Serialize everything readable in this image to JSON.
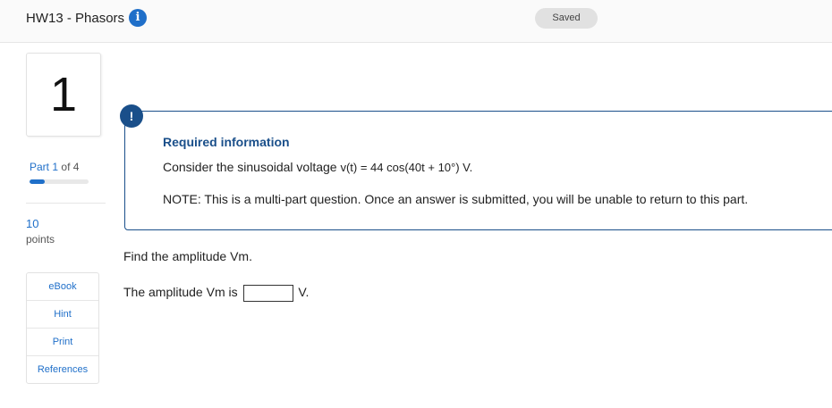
{
  "header": {
    "title": "HW13 - Phasors",
    "info_icon": "info-icon",
    "saved_label": "Saved"
  },
  "sidebar": {
    "question_number": "1",
    "part_word": "Part",
    "part_current": "1",
    "part_of": "of 4",
    "progress_fraction": 0.25,
    "points_value": "10",
    "points_label": "points",
    "tools": [
      {
        "label": "eBook"
      },
      {
        "label": "Hint"
      },
      {
        "label": "Print"
      },
      {
        "label": "References"
      }
    ]
  },
  "required_info": {
    "badge": "!",
    "title": "Required information",
    "body_prefix": "Consider the sinusoidal voltage ",
    "equation": "v(t) = 44 cos(40t + 10°) V.",
    "note": "NOTE: This is a multi-part question. Once an answer is submitted, you will be unable to return to this part."
  },
  "question": {
    "prompt": "Find the amplitude Vm.",
    "answer_prefix": "The amplitude Vm is",
    "answer_value": "",
    "answer_unit": "V."
  },
  "colors": {
    "accent": "#1f6fc9",
    "alert_navy": "#1a4f8a",
    "saved_badge_bg": "#e1e1e1"
  }
}
